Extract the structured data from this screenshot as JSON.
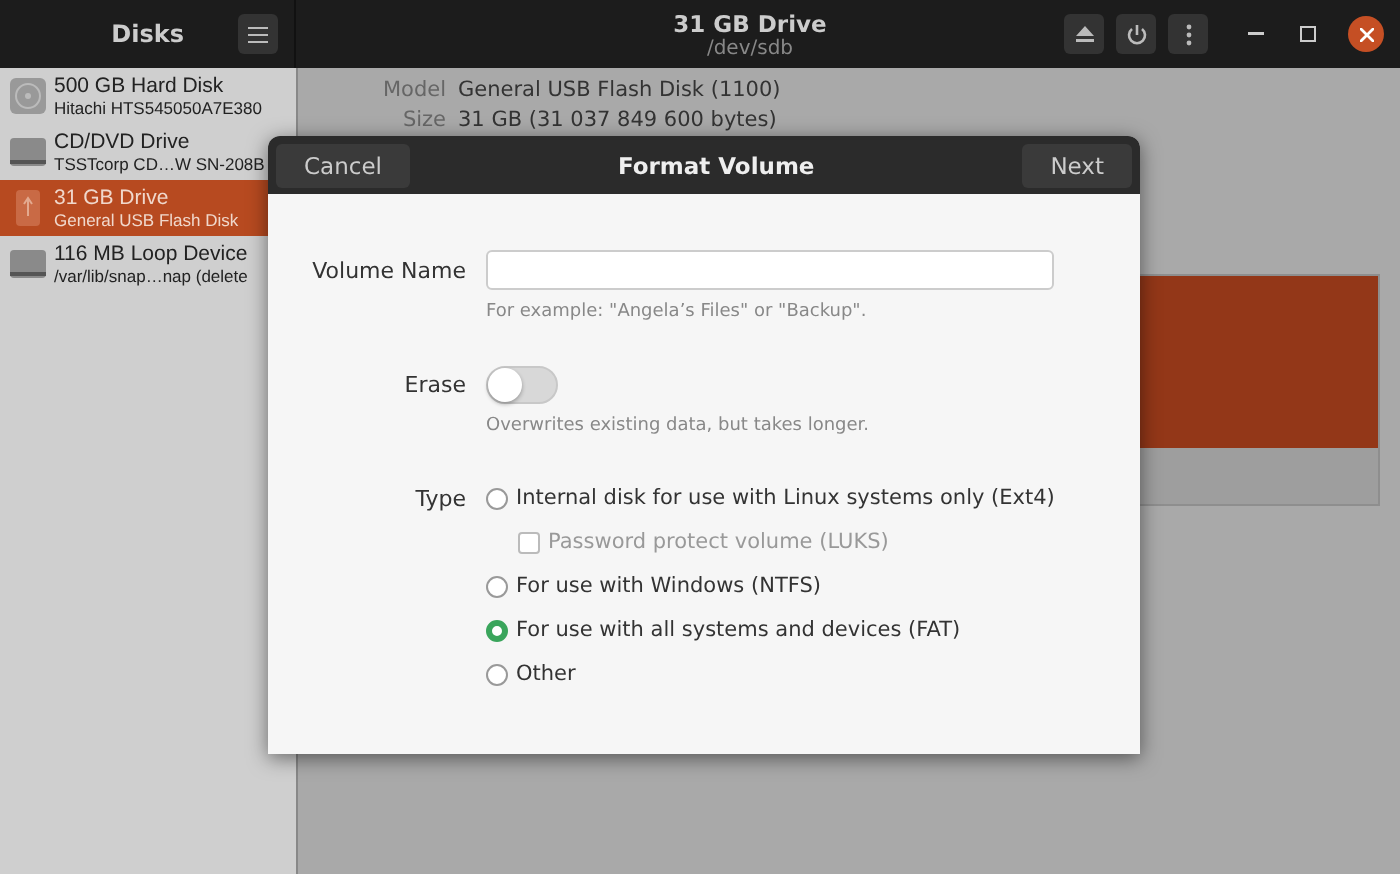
{
  "sidebar": {
    "title": "Disks",
    "items": [
      {
        "kind": "hdd",
        "name": "500 GB Hard Disk",
        "detail": "Hitachi HTS545050A7E380",
        "selected": false
      },
      {
        "kind": "optical",
        "name": "CD/DVD Drive",
        "detail": "TSSTcorp CD…W SN-208B",
        "selected": false
      },
      {
        "kind": "usb",
        "name": "31 GB Drive",
        "detail": "General USB Flash Disk",
        "selected": true
      },
      {
        "kind": "loop",
        "name": "116 MB Loop Device",
        "detail": "/var/lib/snap…nap (delete",
        "selected": false
      }
    ]
  },
  "header": {
    "title": "31 GB Drive",
    "subtitle": "/dev/sdb"
  },
  "details": [
    {
      "label": "Model",
      "value": "General USB Flash Disk (1100)"
    },
    {
      "label": "Size",
      "value": "31 GB (31 037 849 600 bytes)"
    }
  ],
  "dialog": {
    "title": "Format Volume",
    "cancel": "Cancel",
    "next": "Next",
    "volume_name": {
      "label": "Volume Name",
      "hint": "For example: \"Angela’s Files\" or \"Backup\"."
    },
    "erase": {
      "label": "Erase",
      "on": false,
      "hint": "Overwrites existing data, but takes longer."
    },
    "type": {
      "label": "Type",
      "options": [
        {
          "kind": "radio",
          "label": "Internal disk for use with Linux systems only (Ext4)",
          "selected": false
        },
        {
          "kind": "checkbox",
          "label": "Password protect volume (LUKS)",
          "checked": false,
          "disabled": true
        },
        {
          "kind": "radio",
          "label": "For use with Windows (NTFS)",
          "selected": false
        },
        {
          "kind": "radio",
          "label": "For use with all systems and devices (FAT)",
          "selected": true
        },
        {
          "kind": "radio",
          "label": "Other",
          "selected": false
        }
      ]
    }
  }
}
